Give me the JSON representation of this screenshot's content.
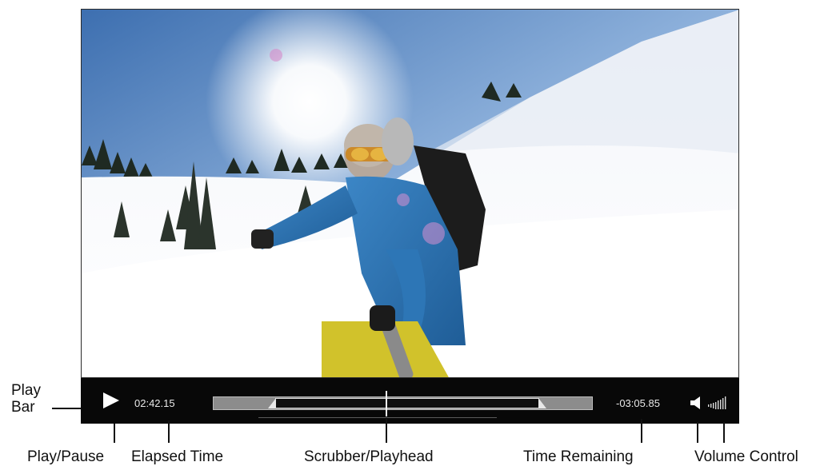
{
  "player": {
    "elapsed_time": "02:42.15",
    "time_remaining": "-03:05.85",
    "progress_percent": 46,
    "volume_level": 1.0
  },
  "callouts": {
    "play_bar": [
      "Play",
      "Bar"
    ],
    "play_pause": "Play/Pause",
    "elapsed_time": "Elapsed Time",
    "scrubber": "Scrubber/Playhead",
    "time_remaining": "Time Remaining",
    "volume_control": "Volume Control"
  },
  "icons": {
    "play": "play-icon",
    "speaker": "speaker-icon",
    "volume": "volume-bars-icon"
  },
  "colors": {
    "play_bar_bg": "#080808",
    "track": "#8c8c8c",
    "text": "#e8e8e8"
  }
}
